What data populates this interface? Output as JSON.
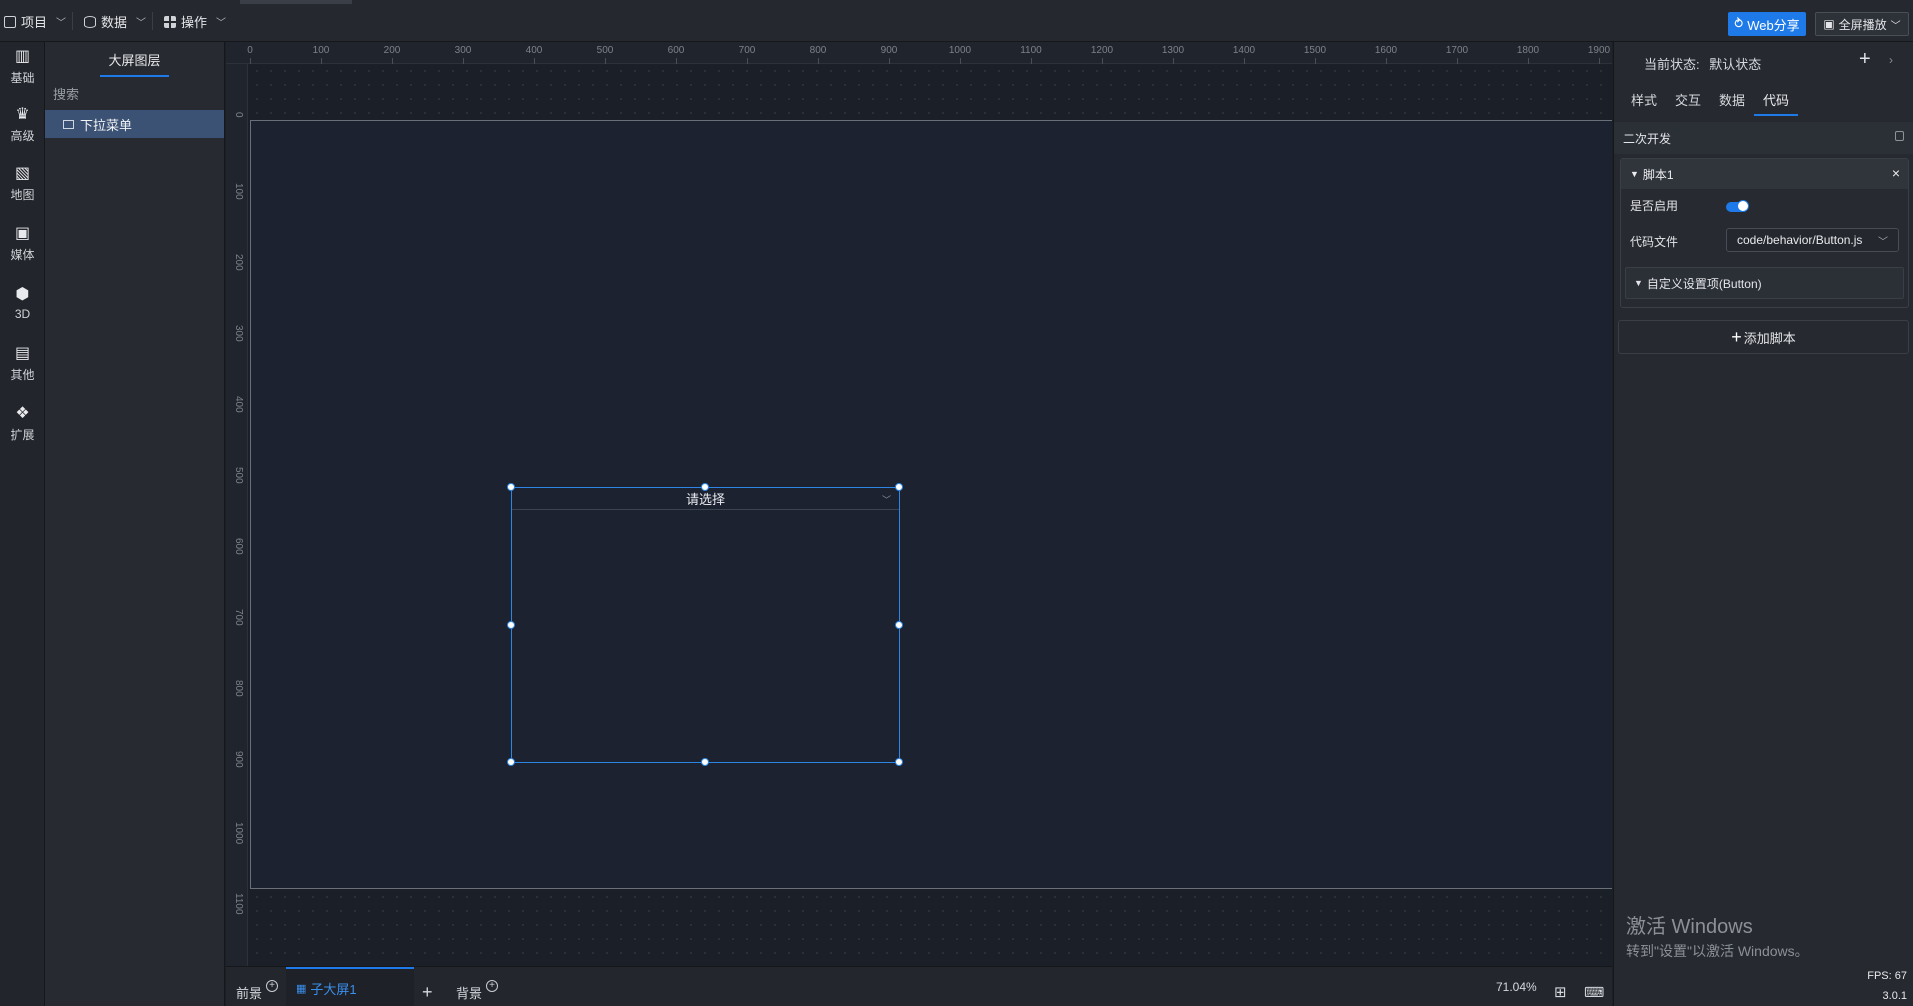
{
  "topbar": {
    "menus": [
      {
        "label": "项目",
        "icon": "file-icon"
      },
      {
        "label": "数据",
        "icon": "database-icon"
      },
      {
        "label": "操作",
        "icon": "grid-icon"
      }
    ],
    "share_label": "Web分享",
    "fullscreen_label": "全屏播放"
  },
  "sidebar": {
    "items": [
      {
        "label": "基础",
        "icon": "bar-chart-icon"
      },
      {
        "label": "高级",
        "icon": "crown-icon"
      },
      {
        "label": "地图",
        "icon": "map-icon"
      },
      {
        "label": "媒体",
        "icon": "media-icon"
      },
      {
        "label": "3D",
        "icon": "cube-icon"
      },
      {
        "label": "其他",
        "icon": "list-icon"
      },
      {
        "label": "扩展",
        "icon": "puzzle-icon"
      }
    ]
  },
  "layers": {
    "title": "大屏图层",
    "search_placeholder": "搜索",
    "items": [
      {
        "label": "下拉菜单",
        "selected": true
      }
    ]
  },
  "ruler": {
    "top": [
      "0",
      "100",
      "200",
      "300",
      "400",
      "500",
      "600",
      "700",
      "800",
      "900",
      "1000",
      "1100",
      "1200",
      "1300",
      "1400",
      "1500",
      "1600",
      "1700",
      "1800",
      "1900"
    ],
    "left": [
      "0",
      "100",
      "200",
      "300",
      "400",
      "500",
      "600",
      "700",
      "800",
      "900",
      "1000",
      "1100"
    ]
  },
  "canvas": {
    "dropdown_placeholder": "请选择"
  },
  "bottombar": {
    "foreground_label": "前景",
    "active_tab_label": "子大屏1",
    "background_label": "背景",
    "zoom": "71.04%"
  },
  "right_panel": {
    "state_label": "当前状态:",
    "state_value": "默认状态",
    "tabs": [
      "样式",
      "交互",
      "数据",
      "代码"
    ],
    "active_tab": "代码",
    "section_title": "二次开发",
    "script": {
      "title": "脚本1",
      "enable_label": "是否启用",
      "enabled": true,
      "file_label": "代码文件",
      "file_value": "code/behavior/Button.js",
      "custom_section": "自定义设置项(Button)"
    },
    "add_script_label": "添加脚本"
  },
  "system": {
    "activate_title": "激活 Windows",
    "activate_hint": "转到\"设置\"以激活 Windows。",
    "fps": "FPS: 67",
    "version": "3.0.1"
  },
  "colors": {
    "accent": "#1e7ae8",
    "canvas_bg": "#1d2230",
    "panel_bg": "#26292f"
  }
}
